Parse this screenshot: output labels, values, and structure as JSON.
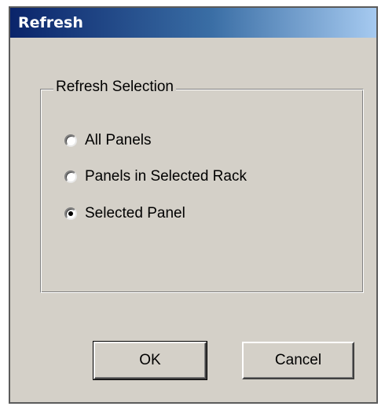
{
  "window": {
    "title": "Refresh"
  },
  "group": {
    "label": "Refresh Selection",
    "options": [
      {
        "label": "All Panels",
        "checked": false
      },
      {
        "label": "Panels in Selected Rack",
        "checked": false
      },
      {
        "label": "Selected Panel",
        "checked": true
      }
    ]
  },
  "buttons": {
    "ok_label": "OK",
    "cancel_label": "Cancel"
  }
}
